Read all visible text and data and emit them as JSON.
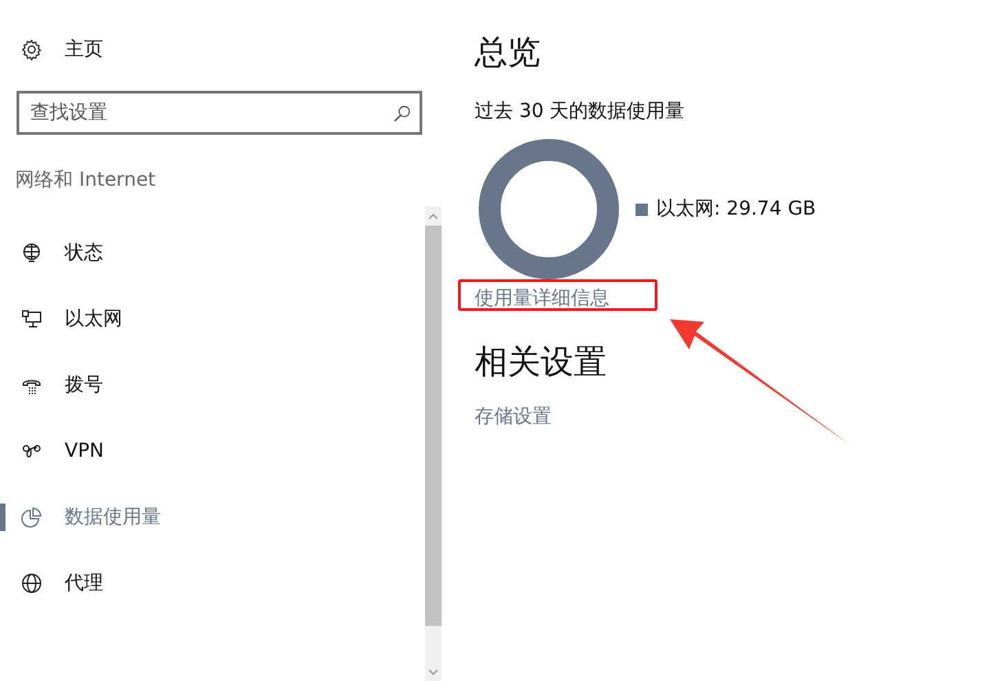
{
  "sidebar": {
    "home": {
      "label": "主页"
    },
    "search": {
      "placeholder": "查找设置"
    },
    "section_title": "网络和 Internet",
    "items": [
      {
        "label": "状态",
        "kind": "status",
        "selected": false
      },
      {
        "label": "以太网",
        "kind": "ethernet",
        "selected": false
      },
      {
        "label": "拨号",
        "kind": "dialup",
        "selected": false
      },
      {
        "label": "VPN",
        "kind": "vpn",
        "selected": false
      },
      {
        "label": "数据使用量",
        "kind": "data",
        "selected": true
      },
      {
        "label": "代理",
        "kind": "proxy",
        "selected": false
      }
    ]
  },
  "main": {
    "title": "总览",
    "subtitle": "过去 30 天的数据使用量",
    "legend": [
      {
        "label": "以太网: 29.74 GB",
        "color": "#67768a"
      }
    ],
    "details_link": "使用量详细信息",
    "related_title": "相关设置",
    "related_links": [
      "存储设置"
    ]
  }
}
